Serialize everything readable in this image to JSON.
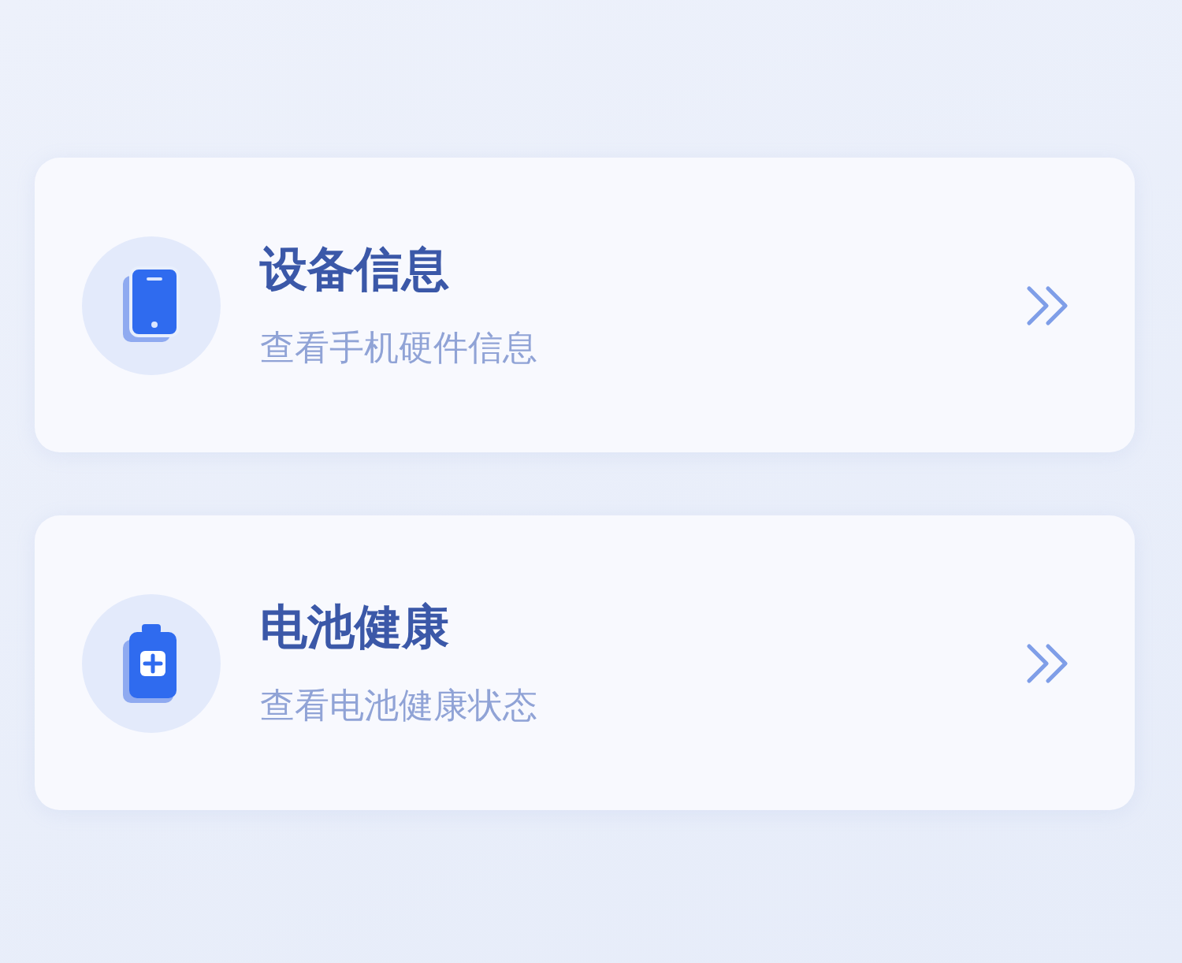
{
  "cards": [
    {
      "kind": "phone",
      "title": "设备信息",
      "subtitle": "查看手机硬件信息"
    },
    {
      "kind": "battery",
      "title": "电池健康",
      "subtitle": "查看电池健康状态"
    }
  ]
}
